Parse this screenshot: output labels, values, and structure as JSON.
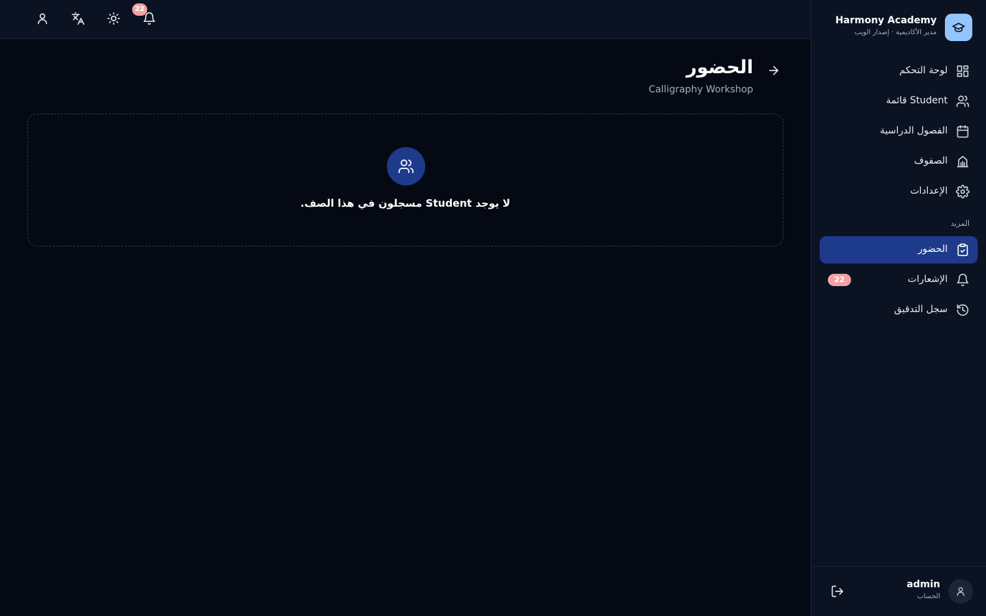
{
  "topbar": {
    "notification_count": "22",
    "icons": [
      "user-icon",
      "translate-icon",
      "sun-icon",
      "bell-icon"
    ]
  },
  "page": {
    "title": "الحضور",
    "subtitle": "Calligraphy Workshop"
  },
  "empty_state": {
    "icon": "users-icon",
    "message": "لا يوجد Student مسجلون في هذا الصف."
  },
  "sidebar": {
    "brand_name": "Harmony Academy",
    "brand_sub": "مدير الأكاديمية · إصدار الويب",
    "items": [
      {
        "label": "لوحة التحكم",
        "icon": "dashboard-icon"
      },
      {
        "label": "قائمة Student",
        "icon": "users-icon"
      },
      {
        "label": "الفصول الدراسية",
        "icon": "calendar-icon"
      },
      {
        "label": "الصفوف",
        "icon": "building-icon"
      },
      {
        "label": "الإعدادات",
        "icon": "gear-icon"
      }
    ],
    "section_label": "المزيد",
    "more_items": [
      {
        "label": "الحضور",
        "icon": "clipboard-icon",
        "active": true
      },
      {
        "label": "الإشعارات",
        "icon": "bell-icon",
        "badge": "22"
      },
      {
        "label": "سجل التدقيق",
        "icon": "history-icon"
      }
    ]
  },
  "user": {
    "name": "admin",
    "sub": "الحساب"
  },
  "colors": {
    "background": "#050913",
    "panel": "#0b1222",
    "accent": "#1e3a8a",
    "badge": "#f4a1a6",
    "logo": "#93c5fd"
  }
}
